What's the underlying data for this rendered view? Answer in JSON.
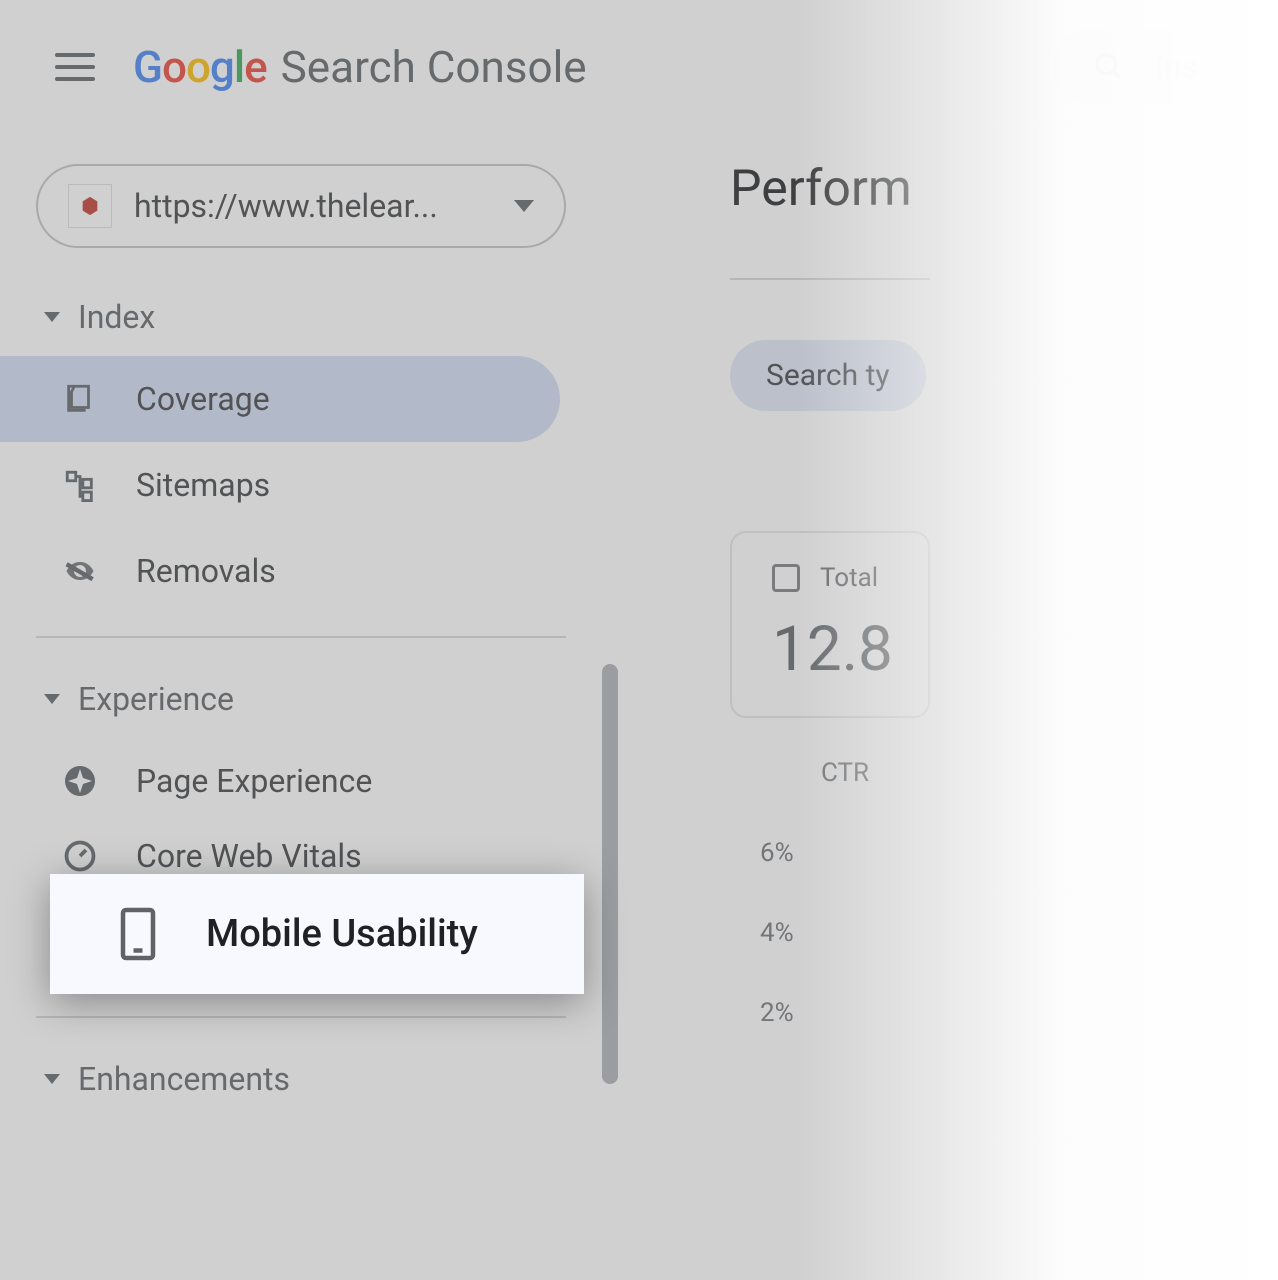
{
  "header": {
    "logo_letters": [
      "G",
      "o",
      "o",
      "g",
      "l",
      "e"
    ],
    "product_name": "Search Console",
    "search_placeholder": "Ins"
  },
  "property": {
    "favicon_glyph": "⬢",
    "url": "https://www.thelear..."
  },
  "sidebar": {
    "sections": [
      {
        "title": "Index",
        "items": [
          {
            "label": "Coverage",
            "active": true
          },
          {
            "label": "Sitemaps",
            "active": false
          },
          {
            "label": "Removals",
            "active": false
          }
        ]
      },
      {
        "title": "Experience",
        "items": [
          {
            "label": "Page Experience",
            "active": false
          },
          {
            "label": "Core Web Vitals",
            "active": false
          },
          {
            "label": "Mobile Usability",
            "active": false,
            "highlighted": true
          }
        ]
      },
      {
        "title": "Enhancements",
        "items": []
      }
    ]
  },
  "main": {
    "title": "Perform",
    "filter_label": "Search ty",
    "card": {
      "label": "Total",
      "value": "12.8"
    },
    "chart": {
      "ctr_label": "CTR",
      "ticks": [
        "6%",
        "4%",
        "2%"
      ]
    }
  }
}
